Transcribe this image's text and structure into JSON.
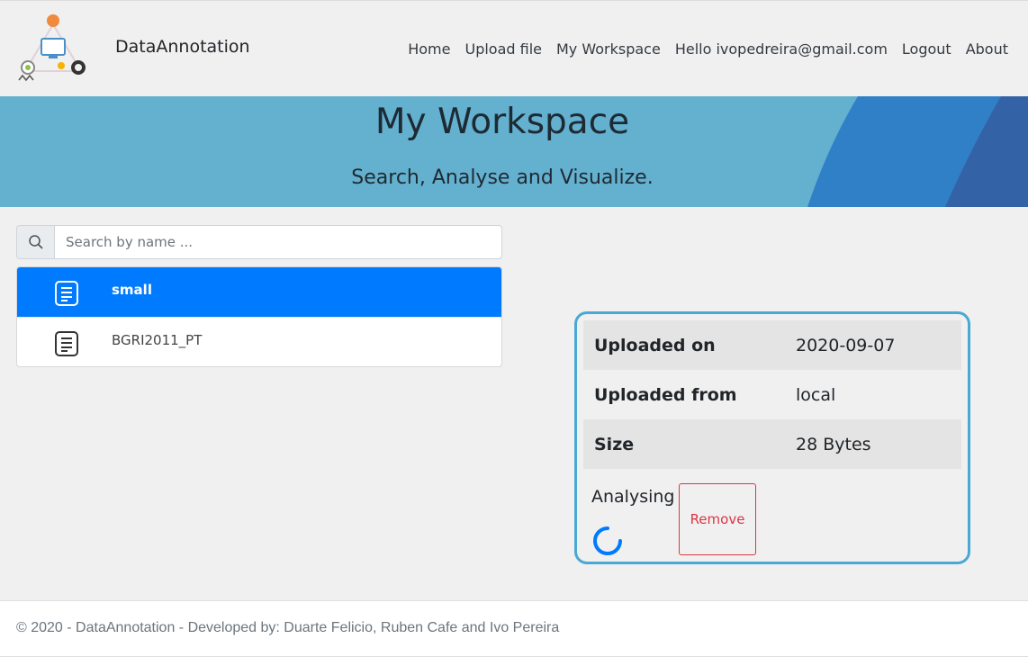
{
  "brand": {
    "name": "DataAnnotation"
  },
  "nav": {
    "items": [
      {
        "label": "Home"
      },
      {
        "label": "Upload file"
      },
      {
        "label": "My Workspace"
      },
      {
        "label": "Hello ivopedreira@gmail.com"
      },
      {
        "label": "Logout"
      },
      {
        "label": "About"
      }
    ]
  },
  "banner": {
    "title": "My Workspace",
    "subtitle": "Search, Analyse and Visualize."
  },
  "search": {
    "placeholder": "Search by name ...",
    "value": ""
  },
  "files": [
    {
      "name": "small",
      "selected": true
    },
    {
      "name": "BGRI2011_PT",
      "selected": false
    }
  ],
  "details": {
    "rows": [
      {
        "key": "Uploaded on",
        "value": "2020-09-07"
      },
      {
        "key": "Uploaded from",
        "value": "local"
      },
      {
        "key": "Size",
        "value": "28 Bytes"
      }
    ],
    "status": "Analysing",
    "remove_label": "Remove"
  },
  "footer": {
    "text": "© 2020 - DataAnnotation - Developed by: Duarte Felicio, Ruben Cafe and Ivo Pereira"
  },
  "colors": {
    "accent": "#007bff",
    "banner": "#64b0cf",
    "danger": "#dc3545",
    "card_border": "#4aa8d4"
  }
}
